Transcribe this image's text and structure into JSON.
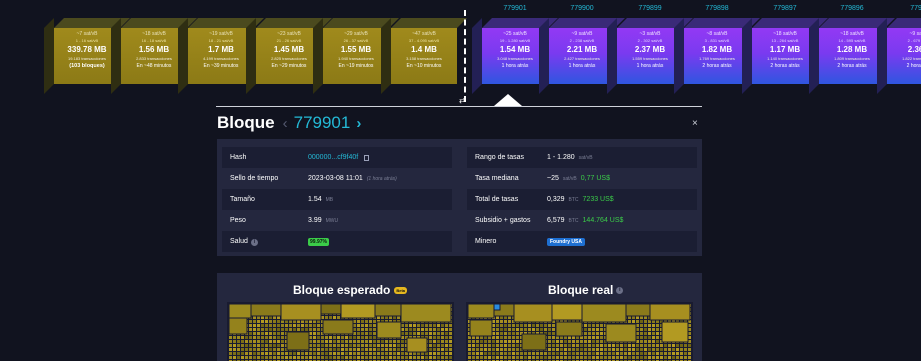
{
  "mempool_blocks": [
    {
      "fee": "~7 sat/vB",
      "range": "1 - 16 sat/vB",
      "size": "339.78 MB",
      "txs": "19.183 transacciones",
      "eta": "(103 bloques)",
      "bold": true
    },
    {
      "fee": "~18 sat/vB",
      "range": "16 - 18 sat/vB",
      "size": "1.56 MB",
      "txs": "2.833 transacciones",
      "eta": "En ~48 minutos",
      "bold": false
    },
    {
      "fee": "~19 sat/vB",
      "range": "18 - 21 sat/vB",
      "size": "1.7 MB",
      "txs": "4.199 transacciones",
      "eta": "En ~39 minutos",
      "bold": false
    },
    {
      "fee": "~23 sat/vB",
      "range": "21 - 26 sat/vB",
      "size": "1.45 MB",
      "txs": "2.825 transacciones",
      "eta": "En ~29 minutos",
      "bold": false
    },
    {
      "fee": "~29 sat/vB",
      "range": "26 - 37 sat/vB",
      "size": "1.55 MB",
      "txs": "1.940 transacciones",
      "eta": "En ~19 minutos",
      "bold": false
    },
    {
      "fee": "~47 sat/vB",
      "range": "37 - 4.095 sat/vB",
      "size": "1.4 MB",
      "txs": "3.158 transacciones",
      "eta": "En ~10 minutos",
      "bold": false
    }
  ],
  "mined_blocks": [
    {
      "height": "779901",
      "fee": "~25 sat/vB",
      "range": "19 - 1.280 sat/vB",
      "size": "1.54 MB",
      "txs": "3.048 transacciones",
      "time": "1 hora atrás"
    },
    {
      "height": "779900",
      "fee": "~9 sat/vB",
      "range": "2 - 238 sat/vB",
      "size": "2.21 MB",
      "txs": "2.427 transacciones",
      "time": "1 hora atrás"
    },
    {
      "height": "779899",
      "fee": "~3 sat/vB",
      "range": "2 - 302 sat/vB",
      "size": "2.37 MB",
      "txs": "1.559 transacciones",
      "time": "1 hora atrás"
    },
    {
      "height": "779898",
      "fee": "~8 sat/vB",
      "range": "3 - 831 sat/vB",
      "size": "1.82 MB",
      "txs": "1.769 transacciones",
      "time": "2 horas atrás"
    },
    {
      "height": "779897",
      "fee": "~18 sat/vB",
      "range": "13 - 264 sat/vB",
      "size": "1.17 MB",
      "txs": "1.140 transacciones",
      "time": "2 horas atrás"
    },
    {
      "height": "779896",
      "fee": "~18 sat/vB",
      "range": "14 - 595 sat/vB",
      "size": "1.28 MB",
      "txs": "1.809 transacciones",
      "time": "2 horas atrás"
    },
    {
      "height": "77989",
      "fee": "~9 sat/vB",
      "range": "2 - 679 sat/vB",
      "size": "2.36 M",
      "txs": "1.822 transacciones",
      "time": "2 horas atrá"
    }
  ],
  "block": {
    "title": "Bloque",
    "height": "779901",
    "prev_glyph": "‹",
    "next_glyph": "›",
    "close_glyph": "×",
    "left_rows": [
      {
        "key": "Hash",
        "value": "000000...cf9f40f"
      },
      {
        "key": "Sello de tiempo",
        "value": "2023-03-08 11:01",
        "extra": "(1 hora atrás)"
      },
      {
        "key": "Tamaño",
        "value": "1.54",
        "unit": "MB"
      },
      {
        "key": "Peso",
        "value": "3.99",
        "unit": "MWU"
      },
      {
        "key": "Salud",
        "value": "99.97%"
      }
    ],
    "right_rows": [
      {
        "key": "Rango de tasas",
        "value": "1 - 1.280",
        "unit": "sat/vB"
      },
      {
        "key": "Tasa mediana",
        "value": "~25",
        "unit": "sat/vB",
        "usd": "0,77 US$"
      },
      {
        "key": "Total de tasas",
        "value": "0,329",
        "unit": "BTC",
        "usd": "7233 US$"
      },
      {
        "key": "Subsidio + gastos",
        "value": "6,579",
        "unit": "BTC",
        "usd": "144.764 US$"
      },
      {
        "key": "Minero",
        "value": "Foundry USA"
      }
    ]
  },
  "comparison": {
    "expected_title": "Bloque esperado",
    "beta_label": "Beta",
    "actual_title": "Bloque real"
  },
  "colors": {
    "accent": "#24b9d6",
    "usd": "#3bcc49",
    "background": "#11131f",
    "card": "#24273e"
  },
  "icons": {
    "swap": "swap-icon",
    "copy": "copy-icon",
    "info": "info-icon",
    "close": "close-icon"
  }
}
